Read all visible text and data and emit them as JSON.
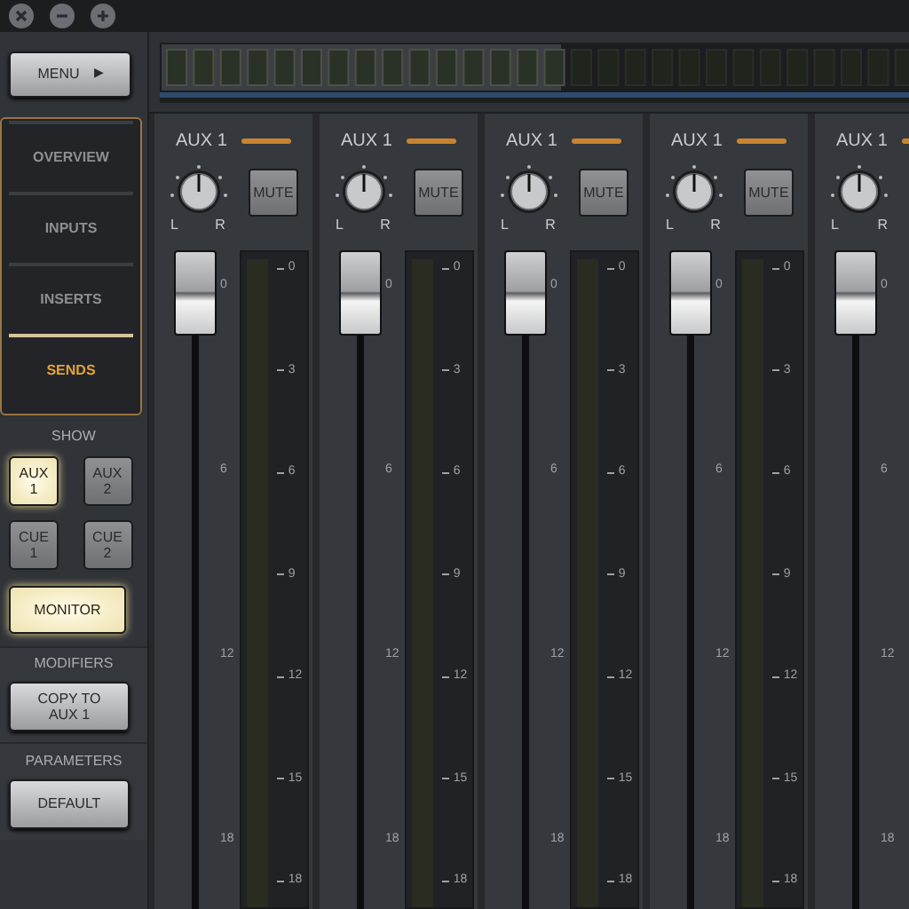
{
  "menu_button": {
    "label": "MENU",
    "arrow": "▶"
  },
  "nav": [
    {
      "label": "OVERVIEW",
      "selected": false
    },
    {
      "label": "INPUTS",
      "selected": false
    },
    {
      "label": "INSERTS",
      "selected": false
    },
    {
      "label": "SENDS",
      "selected": true
    }
  ],
  "show": {
    "title": "SHOW",
    "buttons": [
      {
        "kind": "small",
        "label": "AUX 1",
        "lit": true
      },
      {
        "kind": "small",
        "label": "AUX 2",
        "lit": false
      },
      {
        "kind": "small",
        "label": "CUE 1",
        "lit": false
      },
      {
        "kind": "small",
        "label": "CUE 2",
        "lit": false
      },
      {
        "kind": "wide",
        "label": "MONITOR",
        "lit": true
      }
    ]
  },
  "modifiers": {
    "title": "MODIFIERS",
    "button": "COPY TO AUX 1"
  },
  "parameters": {
    "title": "PARAMETERS",
    "button": "DEFAULT"
  },
  "channels": [
    {
      "name": "AUX 1",
      "pan_left": "L",
      "pan_right": "R",
      "mute": {
        "label": "MUTE",
        "on": false
      },
      "fader": {
        "level": 1
      },
      "fader_scale": [
        "0",
        "6",
        "12",
        "18"
      ],
      "meter_scale": [
        "0",
        "3",
        "6",
        "9",
        "12",
        "15",
        "18"
      ]
    },
    {
      "name": "AUX 1",
      "pan_left": "L",
      "pan_right": "R",
      "mute": {
        "label": "MUTE",
        "on": false
      },
      "fader": {
        "level": 1
      },
      "fader_scale": [
        "0",
        "6",
        "12",
        "18"
      ],
      "meter_scale": [
        "0",
        "3",
        "6",
        "9",
        "12",
        "15",
        "18"
      ]
    },
    {
      "name": "AUX 1",
      "pan_left": "L",
      "pan_right": "R",
      "mute": {
        "label": "MUTE",
        "on": false
      },
      "fader": {
        "level": 1
      },
      "fader_scale": [
        "0",
        "6",
        "12",
        "18"
      ],
      "meter_scale": [
        "0",
        "3",
        "6",
        "9",
        "12",
        "15",
        "18"
      ]
    },
    {
      "name": "AUX 1",
      "pan_left": "L",
      "pan_right": "R",
      "mute": {
        "label": "MUTE",
        "on": false
      },
      "fader": {
        "level": 1
      },
      "fader_scale": [
        "0",
        "6",
        "12",
        "18"
      ],
      "meter_scale": [
        "0",
        "3",
        "6",
        "9",
        "12",
        "15",
        "18"
      ]
    },
    {
      "name": "AUX 1",
      "pan_left": "L",
      "pan_right": "R",
      "fader": {
        "level": 1
      },
      "fader_scale": [
        "0",
        "6",
        "12",
        "18"
      ]
    }
  ]
}
